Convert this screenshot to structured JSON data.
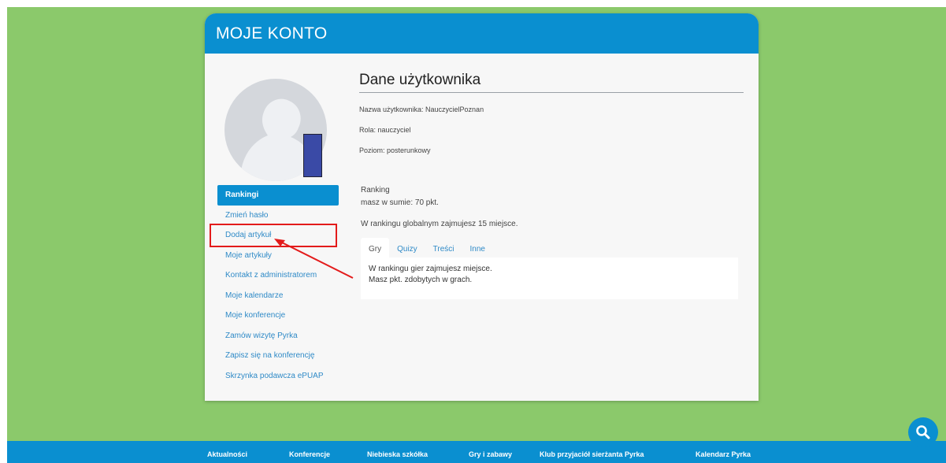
{
  "header": {
    "title": "MOJE KONTO"
  },
  "sidebar": {
    "items": [
      {
        "label": "Rankingi",
        "active": true
      },
      {
        "label": "Zmień hasło"
      },
      {
        "label": "Dodaj artykuł"
      },
      {
        "label": "Moje artykuły"
      },
      {
        "label": "Kontakt z administratorem"
      },
      {
        "label": "Moje kalendarze"
      },
      {
        "label": "Moje konferencje"
      },
      {
        "label": "Zamów wizytę Pyrka"
      },
      {
        "label": "Zapisz się na konferencję"
      },
      {
        "label": "Skrzynka podawcza ePUAP"
      }
    ]
  },
  "user": {
    "title": "Dane użytkownika",
    "username_line": "Nazwa użytkownika: NauczycielPoznan",
    "role_line": "Rola: nauczyciel",
    "level_line": "Poziom: posterunkowy"
  },
  "ranking": {
    "title": "Ranking",
    "sum_line": "masz w sumie: 70 pkt.",
    "global_line": "W rankingu globalnym zajmujesz 15 miejsce.",
    "tabs": [
      "Gry",
      "Quizy",
      "Treści",
      "Inne"
    ],
    "panel_line1": "W rankingu gier zajmujesz miejsce.",
    "panel_line2": "Masz pkt. zdobytych w grach."
  },
  "footer": {
    "links": [
      "Aktualności",
      "Konferencje",
      "Niebieska szkółka",
      "Gry i zabawy",
      "Klub przyjaciół sierżanta Pyrka",
      "Kalendarz Pyrka"
    ]
  },
  "colors": {
    "accent": "#0a8fd0",
    "background": "#8bc96b",
    "annotation": "#e31b1b"
  },
  "icons": {
    "fab": "search-icon"
  }
}
